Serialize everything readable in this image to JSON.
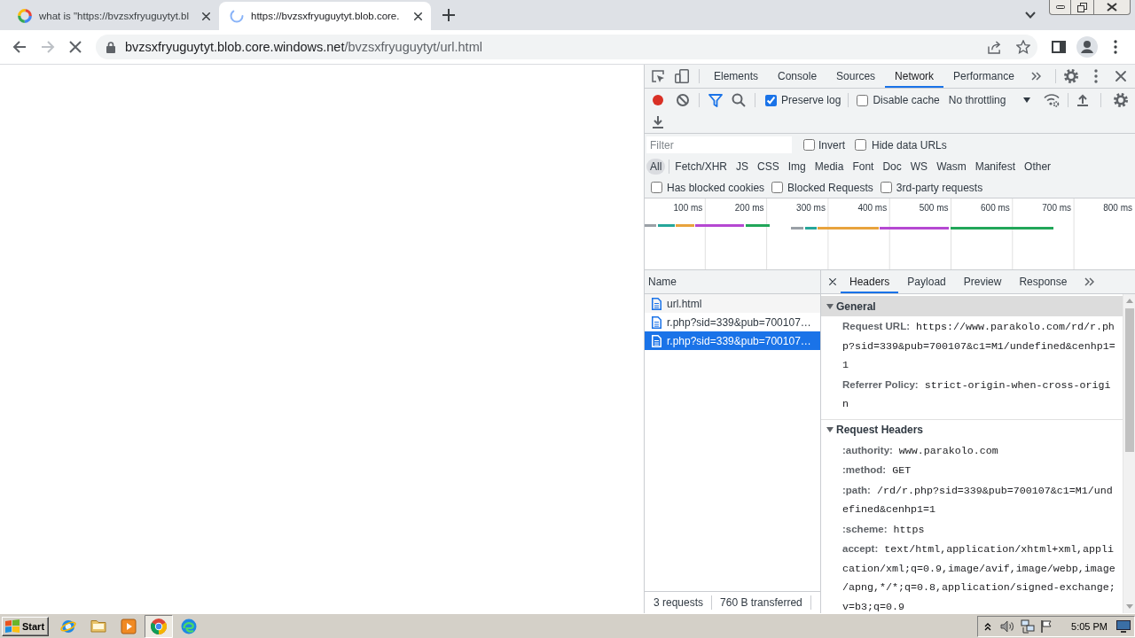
{
  "browser_tabs": [
    {
      "title": "what is \"https://bvzsxfryuguytyt.bl",
      "selected": false,
      "loading": false
    },
    {
      "title": "https://bvzsxfryuguytyt.blob.core.",
      "selected": true,
      "loading": true
    }
  ],
  "navigation": {
    "back": {
      "disabled": false
    },
    "forward": {
      "disabled": true
    }
  },
  "address_bar": {
    "secure": true,
    "host": "bvzsxfryuguytyt.blob.core.windows.net",
    "path": "/bvzsxfryuguytyt/url.html",
    "bookmarked": false
  },
  "devtools": {
    "tabs": [
      {
        "label": "Elements",
        "selected": false
      },
      {
        "label": "Console",
        "selected": false
      },
      {
        "label": "Sources",
        "selected": false
      },
      {
        "label": "Network",
        "selected": true
      },
      {
        "label": "Performance",
        "selected": false
      }
    ],
    "toolbar": {
      "recording": true,
      "filter_open": true,
      "preserve_log": {
        "label": "Preserve log",
        "checked": true
      },
      "disable_cache": {
        "label": "Disable cache",
        "checked": false
      },
      "throttling": "No throttling"
    },
    "filter": {
      "placeholder": "Filter",
      "options": [
        {
          "label": "Invert",
          "checked": false
        },
        {
          "label": "Hide data URLs",
          "checked": false
        }
      ]
    },
    "types": [
      {
        "label": "All",
        "selected": true
      },
      {
        "label": "Fetch/XHR",
        "selected": false
      },
      {
        "label": "JS",
        "selected": false
      },
      {
        "label": "CSS",
        "selected": false
      },
      {
        "label": "Img",
        "selected": false
      },
      {
        "label": "Media",
        "selected": false
      },
      {
        "label": "Font",
        "selected": false
      },
      {
        "label": "Doc",
        "selected": false
      },
      {
        "label": "WS",
        "selected": false
      },
      {
        "label": "Wasm",
        "selected": false
      },
      {
        "label": "Manifest",
        "selected": false
      },
      {
        "label": "Other",
        "selected": false
      }
    ],
    "request_options": [
      {
        "label": "Has blocked cookies",
        "checked": false
      },
      {
        "label": "Blocked Requests",
        "checked": false
      },
      {
        "label": "3rd-party requests",
        "checked": false
      }
    ],
    "timeline": {
      "ticks": [
        "100 ms",
        "200 ms",
        "300 ms",
        "400 ms",
        "500 ms",
        "600 ms",
        "700 ms",
        "800 ms"
      ]
    },
    "requests": {
      "column": "Name",
      "rows": [
        {
          "name": "url.html",
          "selected": false
        },
        {
          "name": "r.php?sid=339&pub=700107…",
          "selected": false
        },
        {
          "name": "r.php?sid=339&pub=700107…",
          "selected": true
        }
      ]
    },
    "status_bar": [
      "3 requests",
      "760 B transferred"
    ],
    "detail_tabs": [
      {
        "label": "Headers",
        "selected": true
      },
      {
        "label": "Payload",
        "selected": false
      },
      {
        "label": "Preview",
        "selected": false
      },
      {
        "label": "Response",
        "selected": false
      }
    ],
    "sections": [
      {
        "title": "General",
        "selected": true,
        "expanded": true,
        "rows": [
          {
            "name": "Request URL:",
            "value": "https://www.parakolo.com/rd/r.php?sid=339&pub=700107&c1=M1/undefined&cenhp1=1"
          },
          {
            "name": "Referrer Policy:",
            "value": "strict-origin-when-cross-origin"
          }
        ]
      },
      {
        "title": "Request Headers",
        "selected": false,
        "expanded": true,
        "rows": [
          {
            "name": ":authority:",
            "value": "www.parakolo.com"
          },
          {
            "name": ":method:",
            "value": "GET"
          },
          {
            "name": ":path:",
            "value": "/rd/r.php?sid=339&pub=700107&c1=M1/undefined&cenhp1=1"
          },
          {
            "name": ":scheme:",
            "value": "https"
          },
          {
            "name": "accept:",
            "value": "text/html,application/xhtml+xml,application/xml;q=0.9,image/avif,image/webp,image/apng,*/*;q=0.8,application/signed-exchange;v=b3;q=0.9"
          }
        ]
      }
    ]
  },
  "taskbar": {
    "start": "Start",
    "apps": [
      {
        "kind": "globe",
        "selected": false
      },
      {
        "kind": "folder",
        "selected": false
      },
      {
        "kind": "player",
        "selected": false
      },
      {
        "kind": "wheel",
        "selected": true
      },
      {
        "kind": "swirl",
        "selected": false
      }
    ],
    "clock": "5:05 PM"
  }
}
